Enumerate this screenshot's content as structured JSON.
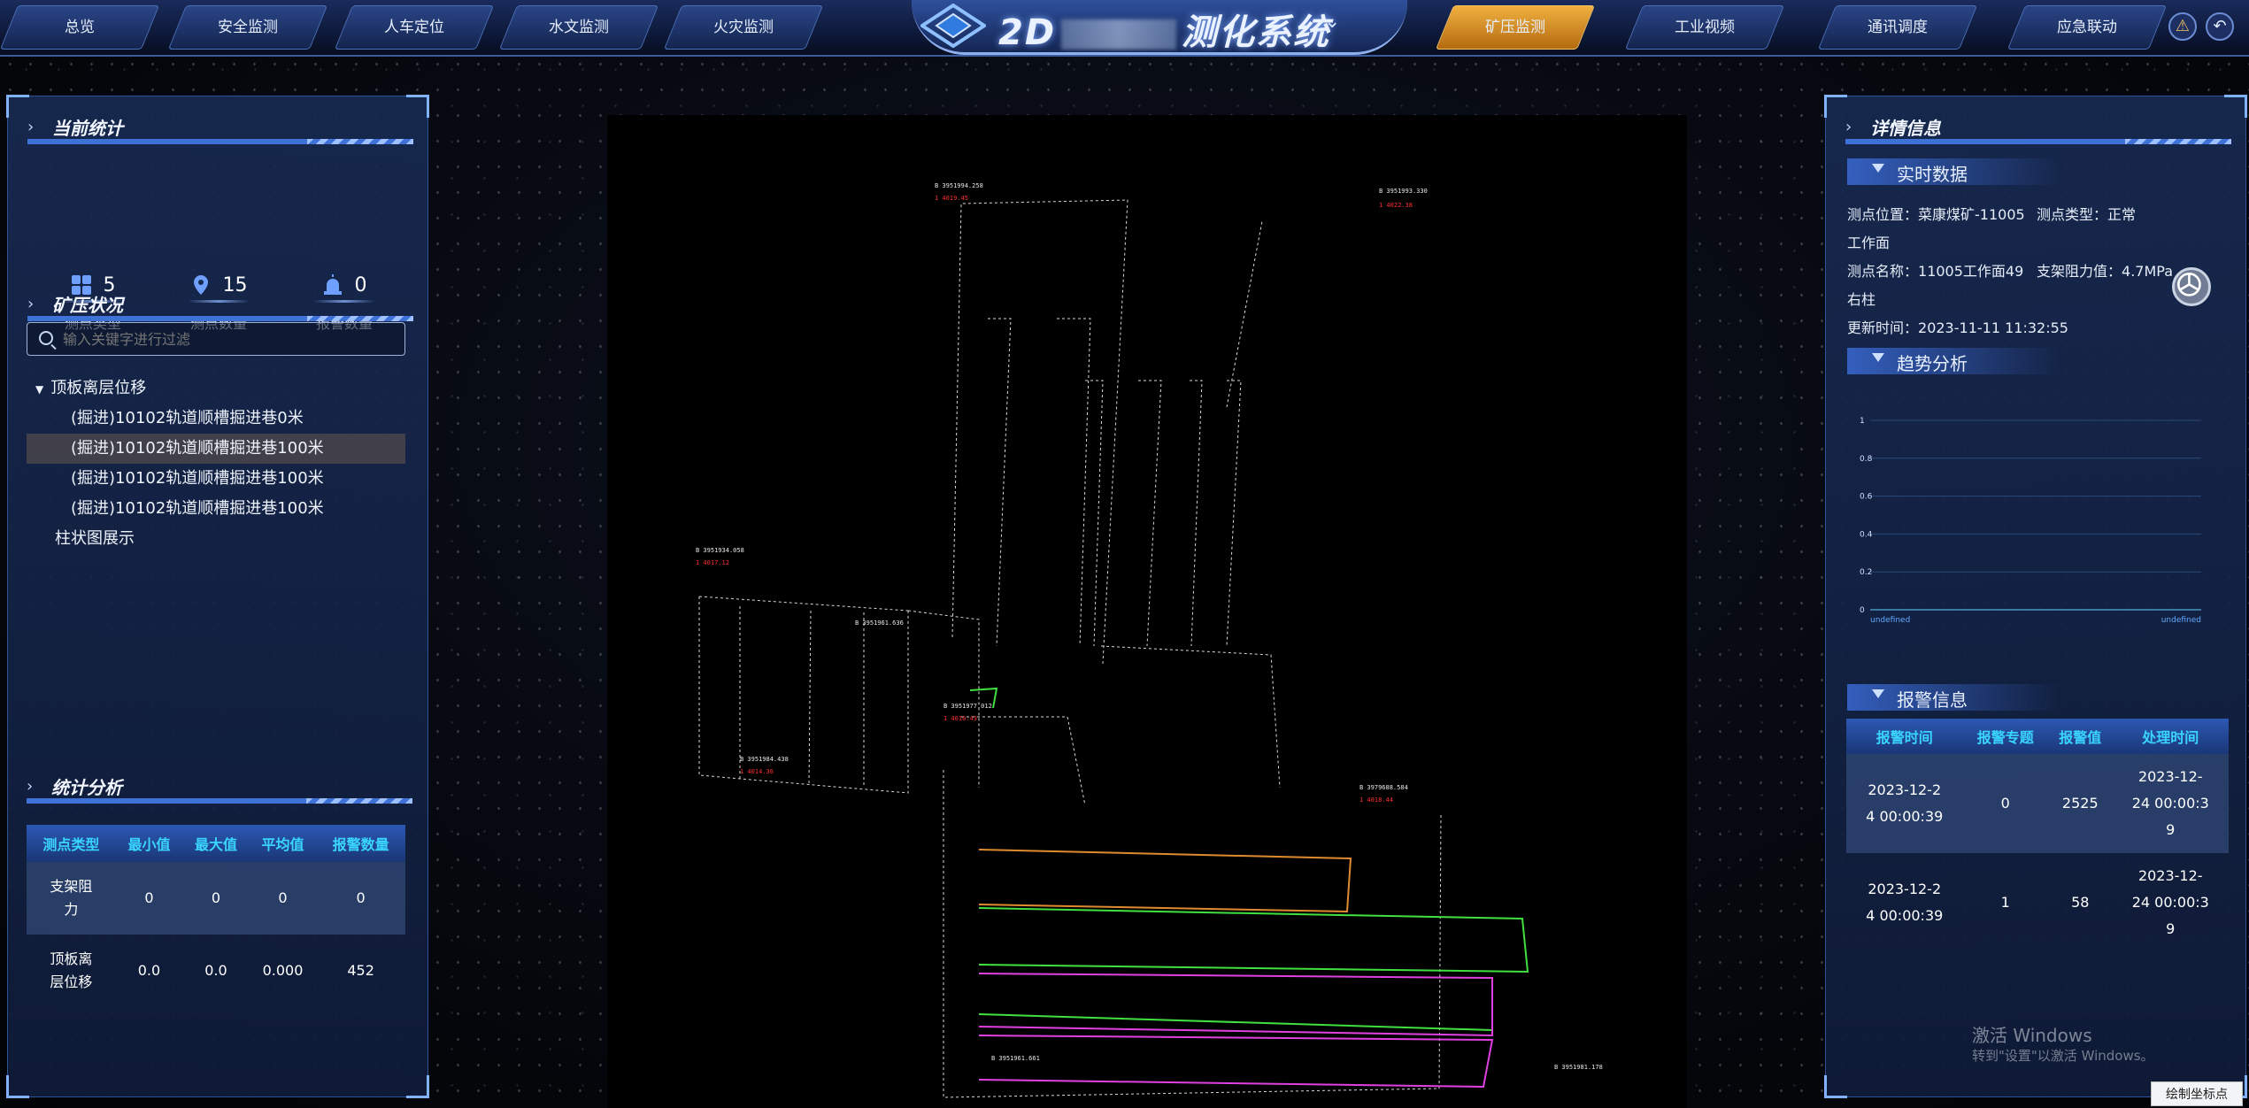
{
  "nav": {
    "tabs_left": [
      "总览",
      "安全监测",
      "人车定位",
      "水文监测",
      "火灾监测"
    ],
    "tabs_right": [
      "矿压监测",
      "工业视频",
      "通讯调度",
      "应急联动"
    ],
    "active_tab": "矿压监测",
    "title_prefix": "2D",
    "title_suffix": "测化系统",
    "chevron": "⌄",
    "alert_icon": "warning-icon",
    "back_icon": "back-icon"
  },
  "left": {
    "stats_title": "当前统计",
    "stats": [
      {
        "icon": "grid-icon",
        "value": "5",
        "label": "测点类型"
      },
      {
        "icon": "location-pin-icon",
        "value": "15",
        "label": "测点数量"
      },
      {
        "icon": "alarm-light-icon",
        "value": "0",
        "label": "报警数量"
      }
    ],
    "pressure_title": "矿压状况",
    "search_placeholder": "输入关键字进行过滤",
    "tree": {
      "root": "顶板离层位移",
      "children": [
        "(掘进)10102轨道顺槽掘进巷0米",
        "(掘进)10102轨道顺槽掘进巷100米",
        "(掘进)10102轨道顺槽掘进巷100米",
        "(掘进)10102轨道顺槽掘进巷100米"
      ],
      "selected_index": 1,
      "extra": "柱状图展示"
    },
    "analysis_title": "统计分析",
    "analysis_table": {
      "headers": [
        "测点类型",
        "最小值",
        "最大值",
        "平均值",
        "报警数量"
      ],
      "rows": [
        [
          "支架阻\n力",
          "0",
          "0",
          "0",
          "0"
        ],
        [
          "顶板离\n层位移",
          "0.0",
          "0.0",
          "0.000",
          "452"
        ]
      ]
    }
  },
  "right": {
    "detail_title": "详情信息",
    "realtime_title": "实时数据",
    "info": {
      "location_label": "测点位置：",
      "location_value": "菜康煤矿-11005",
      "type_label": "测点类型：",
      "type_value": "正常",
      "location_cont": "工作面",
      "name_label": "测点名称：",
      "name_value": "11005工作面49",
      "force_label": "支架阻力值：",
      "force_value": "4.7MPa",
      "name_cont": "右柱",
      "time_label": "更新时间：",
      "time_value": "2023-11-11 11:32:55"
    },
    "trend_title": "趋势分析",
    "alarm_title": "报警信息",
    "alarm_table": {
      "headers": [
        "报警时间",
        "报警专题",
        "报警值",
        "处理时间"
      ],
      "rows": [
        [
          "2023-12-2\n4 00:00:39",
          "0",
          "2525",
          "2023-12-\n24 00:00:3\n9"
        ],
        [
          "2023-12-2\n4 00:00:39",
          "1",
          "58",
          "2023-12-\n24 00:00:3\n9"
        ]
      ]
    }
  },
  "chart_data": {
    "type": "line",
    "x": [
      "undefined",
      "undefined"
    ],
    "series": [],
    "ylim": [
      0,
      1
    ],
    "yticks": [
      "0",
      "0.2",
      "0.4",
      "0.6",
      "0.8",
      "1"
    ],
    "xlabel": "",
    "ylabel": "",
    "title": "",
    "grid": true
  },
  "watermark": {
    "line1": "激活 Windows",
    "line2": "转到\"设置\"以激活 Windows。"
  },
  "plot_button": "绘制坐标点",
  "colors": {
    "accent": "#39d5ff",
    "active_tab": "#e8a030",
    "panel": "#172a52",
    "alarm": "#ff3030"
  }
}
